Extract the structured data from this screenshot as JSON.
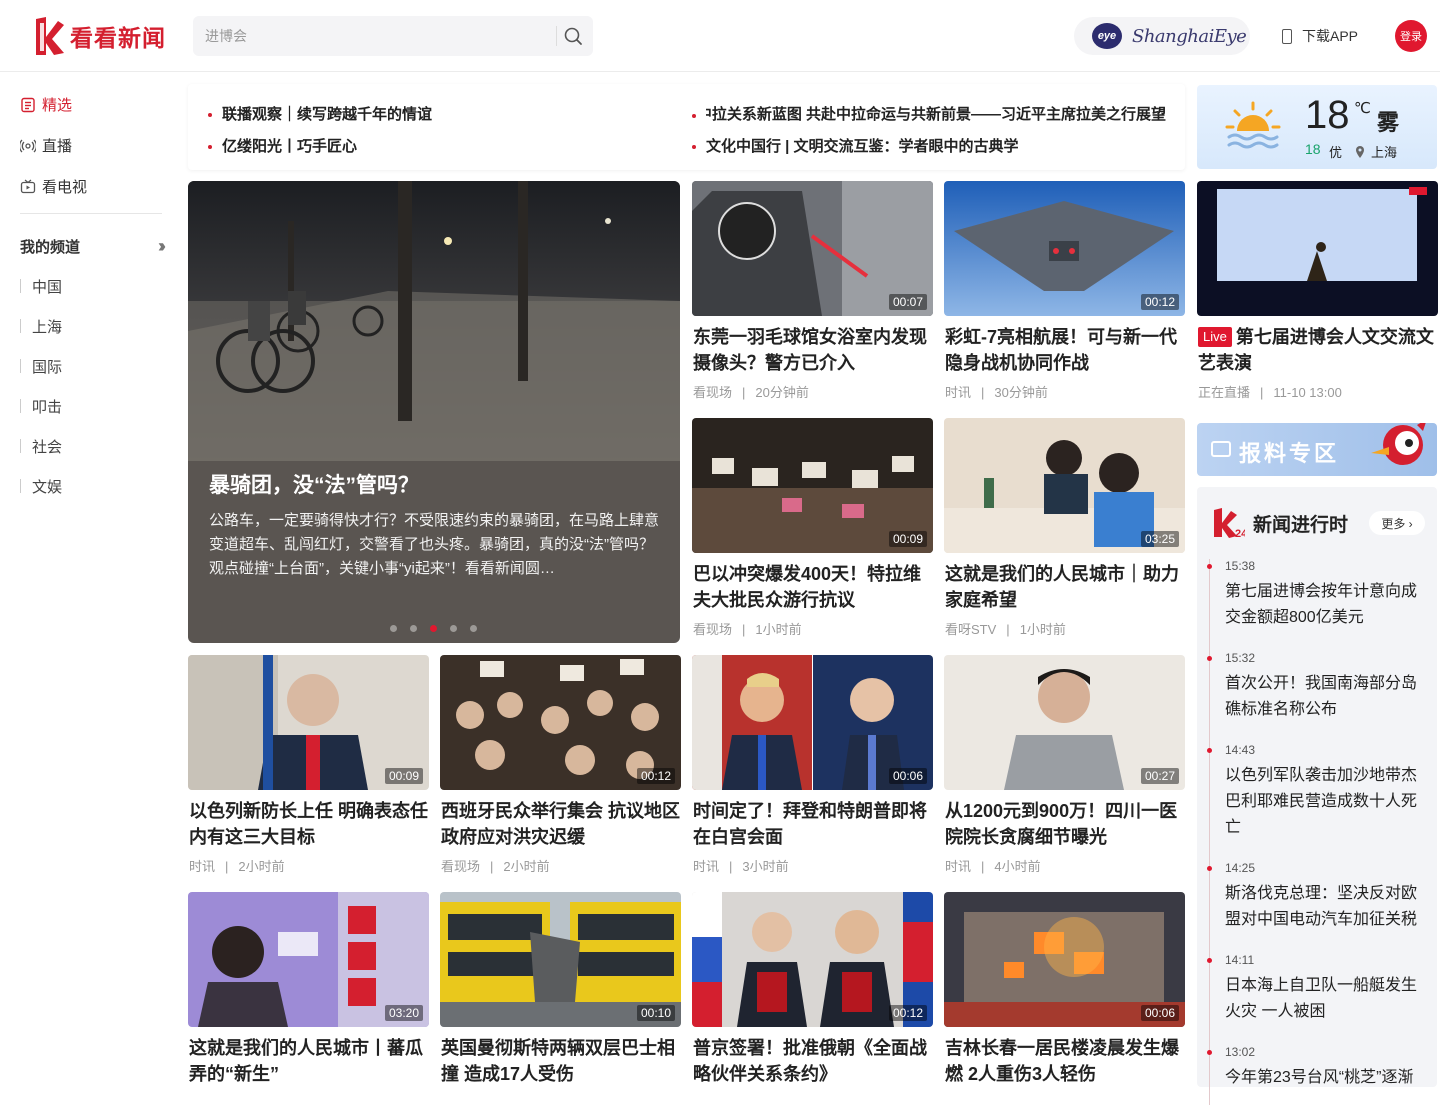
{
  "brand": {
    "name": "看看新闻",
    "accent": "#d41f2f"
  },
  "search": {
    "placeholder": "进博会"
  },
  "header": {
    "shanghai_eye_badge": "eye",
    "shanghai_eye": "ShanghaiEye",
    "download": "下载APP",
    "login": "登录"
  },
  "nav": {
    "items": [
      {
        "label": "精选",
        "icon": "featured-icon",
        "active": true
      },
      {
        "label": "直播",
        "icon": "live-icon"
      },
      {
        "label": "看电视",
        "icon": "tv-icon"
      }
    ],
    "my_channels": "我的频道",
    "channels": [
      "中国",
      "上海",
      "国际",
      "叩击",
      "社会",
      "文娱"
    ]
  },
  "ticker": [
    "联播观察｜续写跨越千年的情谊",
    "描绘中拉关系新蓝图 共赴中拉命运与共新前景——习近平主席拉美之行展望",
    "亿缕阳光丨巧手匠心",
    "文化中国行 | 文明交流互鉴：学者眼中的古典学"
  ],
  "weather": {
    "temp": "18",
    "unit": "℃",
    "condition": "雾",
    "aqi": "18",
    "aqi_label": "优",
    "city": "上海"
  },
  "hero": {
    "title": "暴骑团，没“法”管吗？",
    "description": "公路车，一定要骑得快才行？不受限速约束的暴骑团，在马路上肆意变道超车、乱闯红灯，交警看了也头疼。暴骑团，真的没“法”管吗？观点碰撞“上台面”，关键小事“yi起来”！看看新闻圆…",
    "slide_count": 5,
    "active_slide": 3
  },
  "cards": [
    {
      "title": "东莞一羽毛球馆女浴室内发现摄像头？警方已介入",
      "source": "看现场",
      "time": "20分钟前",
      "duration": "00:07"
    },
    {
      "title": "彩虹-7亮相航展！可与新一代隐身战机协同作战",
      "source": "时讯",
      "time": "30分钟前",
      "duration": "00:12"
    },
    {
      "title": "第七届进博会人文交流文艺表演",
      "source": "正在直播",
      "time": "11-10 13:00",
      "live": "Live"
    },
    {
      "title": "巴以冲突爆发400天！特拉维夫大批民众游行抗议",
      "source": "看现场",
      "time": "1小时前",
      "duration": "00:09"
    },
    {
      "title": "这就是我们的人民城市｜助力家庭希望",
      "source": "看呀STV",
      "time": "1小时前",
      "duration": "03:25"
    },
    {
      "title": "以色列新防长上任 明确表态任内有这三大目标",
      "source": "时讯",
      "time": "2小时前",
      "duration": "00:09"
    },
    {
      "title": "西班牙民众举行集会 抗议地区政府应对洪灾迟缓",
      "source": "看现场",
      "time": "2小时前",
      "duration": "00:12"
    },
    {
      "title": "时间定了！拜登和特朗普即将在白宫会面",
      "source": "时讯",
      "time": "3小时前",
      "duration": "00:06"
    },
    {
      "title": "从1200元到900万！四川一医院院长贪腐细节曝光",
      "source": "时讯",
      "time": "4小时前",
      "duration": "00:27"
    },
    {
      "title": "这就是我们的人民城市丨蕃瓜弄的“新生”",
      "duration": "03:20"
    },
    {
      "title": "英国曼彻斯特两辆双层巴士相撞 造成17人受伤",
      "duration": "00:10"
    },
    {
      "title": "普京签署！批准俄朝《全面战略伙伴关系条约》",
      "duration": "00:12"
    },
    {
      "title": "吉林长春一居民楼凌晨发生爆燃 2人重伤3人轻伤",
      "duration": "00:06"
    }
  ],
  "report": {
    "label": "报料专区"
  },
  "live_news": {
    "title": "新闻进行时",
    "more": "更多 ›",
    "items": [
      {
        "time": "15:38",
        "text": "第七届进博会按年计意向成交金额超800亿美元"
      },
      {
        "time": "15:32",
        "text": "首次公开！我国南海部分岛礁标准名称公布"
      },
      {
        "time": "14:43",
        "text": "以色列军队袭击加沙地带杰巴利耶难民营造成数十人死亡"
      },
      {
        "time": "14:25",
        "text": "斯洛伐克总理：坚决反对欧盟对中国电动汽车加征关税"
      },
      {
        "time": "14:11",
        "text": "日本海上自卫队一船艇发生火灾 一人被困"
      },
      {
        "time": "13:02",
        "text": "今年第23号台风“桃芝”逐渐"
      }
    ]
  }
}
